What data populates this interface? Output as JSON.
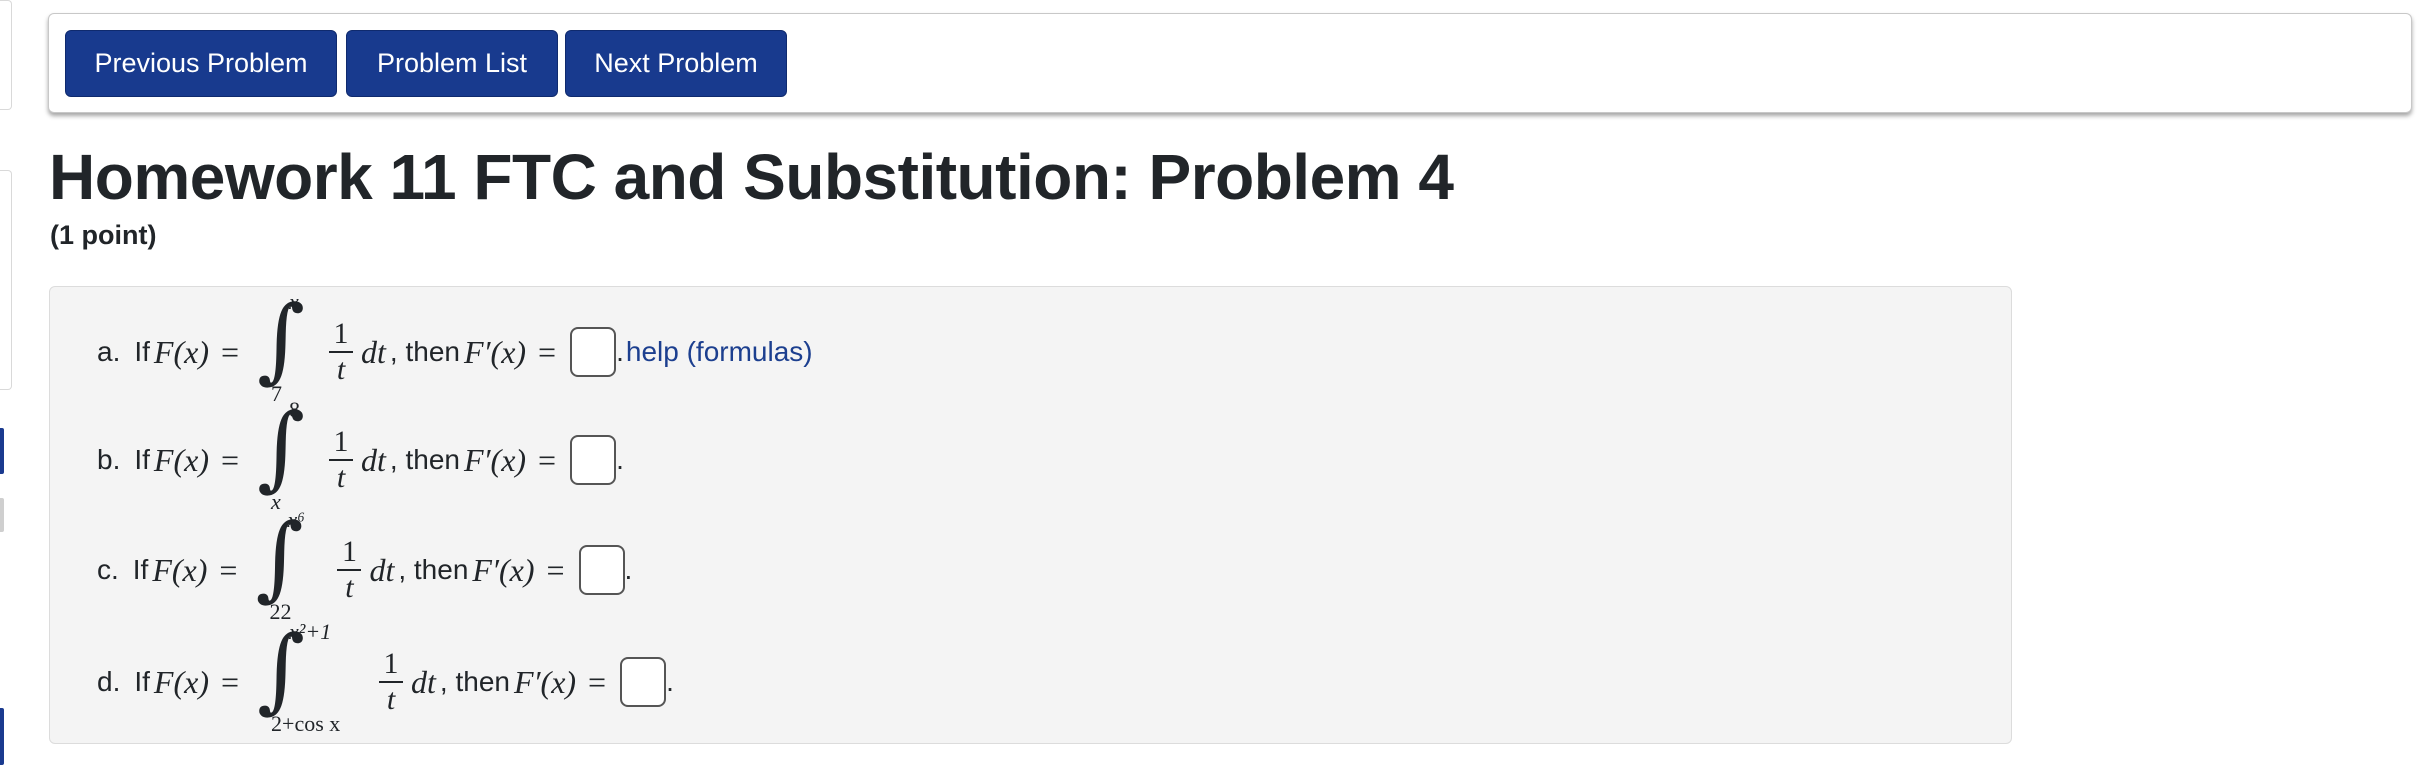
{
  "nav": {
    "prev": "Previous Problem",
    "list": "Problem List",
    "next": "Next Problem"
  },
  "title": "Homework 11 FTC and Substitution: Problem 4",
  "points": "(1 point)",
  "parts": [
    {
      "label": "a.",
      "if": "If",
      "func": "F(x)",
      "upper": "x",
      "lower": "7",
      "num": "1",
      "den": "t",
      "dt": "dt",
      "then": ", then",
      "deriv": "F′(x)",
      "after": "."
    },
    {
      "label": "b.",
      "if": "If",
      "func": "F(x)",
      "upper": "8",
      "lower": "x",
      "num": "1",
      "den": "t",
      "dt": "dt",
      "then": ", then",
      "deriv": "F′(x)",
      "after": "."
    },
    {
      "label": "c.",
      "if": "If",
      "func": "F(x)",
      "upper": "x⁶",
      "lower": "22",
      "num": "1",
      "den": "t",
      "dt": "dt",
      "then": ", then",
      "deriv": "F′(x)",
      "after": "."
    },
    {
      "label": "d.",
      "if": "If",
      "func": "F(x)",
      "upper": "x²+1",
      "lower": "2+cos x",
      "num": "1",
      "den": "t",
      "dt": "dt",
      "then": ", then",
      "deriv": "F′(x)",
      "after": "."
    }
  ],
  "help_link": "help (formulas)",
  "colors": {
    "button": "#183a8e",
    "link": "#1c3f8f",
    "panel": "#f4f4f4"
  }
}
